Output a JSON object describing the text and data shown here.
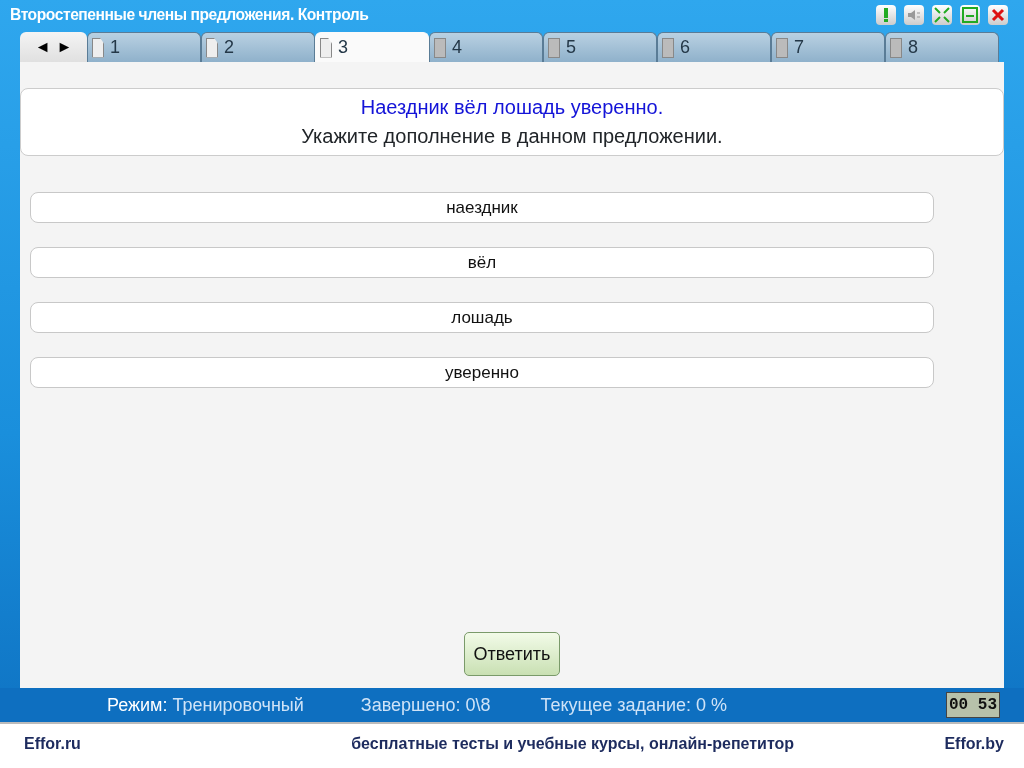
{
  "window": {
    "title": "Второстепенные члены предложения. Контроль"
  },
  "toolbar": [
    {
      "kind": "alert"
    },
    {
      "kind": "sound"
    },
    {
      "kind": "collapse"
    },
    {
      "kind": "save"
    },
    {
      "kind": "close"
    }
  ],
  "nav": {
    "prev": "◄",
    "next": "►"
  },
  "tabs": [
    {
      "label": "1",
      "selected": false,
      "visited": true
    },
    {
      "label": "2",
      "selected": false,
      "visited": true
    },
    {
      "label": "3",
      "selected": true,
      "visited": true
    },
    {
      "label": "4",
      "selected": false,
      "visited": false
    },
    {
      "label": "5",
      "selected": false,
      "visited": false
    },
    {
      "label": "6",
      "selected": false,
      "visited": false
    },
    {
      "label": "7",
      "selected": false,
      "visited": false
    },
    {
      "label": "8",
      "selected": false,
      "visited": false
    }
  ],
  "question": {
    "sentence": "Наездник вёл лошадь уверенно.",
    "prompt": "Укажите дополнение в данном предложении."
  },
  "options": [
    {
      "label": "наездник"
    },
    {
      "label": "вёл"
    },
    {
      "label": "лошадь"
    },
    {
      "label": "уверенно"
    }
  ],
  "answer_button": "Ответить",
  "status_bar": {
    "mode_label": "Режим:",
    "mode": "Тренировочный",
    "completed": "Завершено: 0\\8",
    "current": "Текущее задание: 0 %",
    "timer": "00 53"
  },
  "footer": {
    "left": "Effor.ru",
    "center": "бесплатные тесты и учебные курсы, онлайн-репетитор",
    "right": "Effor.by"
  }
}
